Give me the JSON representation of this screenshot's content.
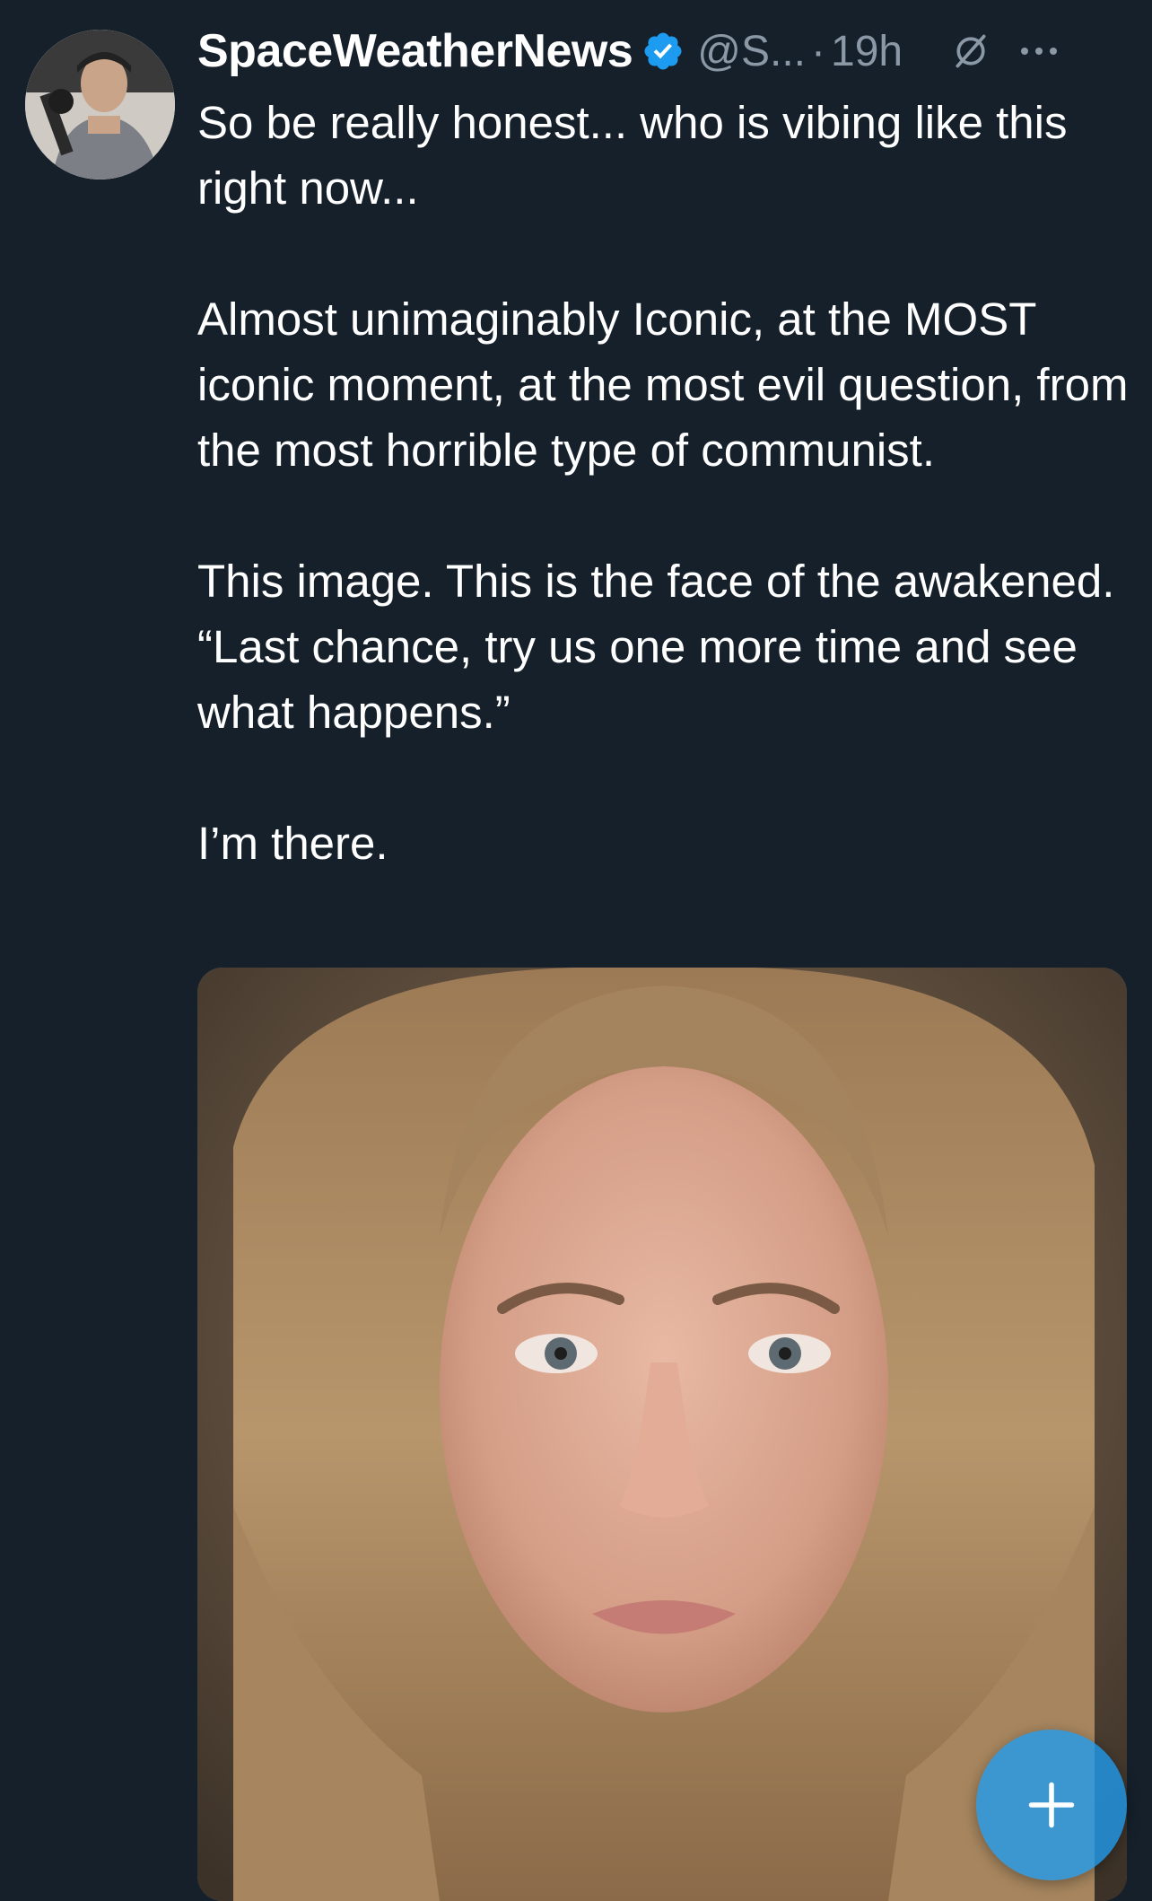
{
  "tweet": {
    "display_name": "SpaceWeatherNews",
    "handle": "@S...",
    "separator": "·",
    "time": "19h",
    "paragraphs": [
      "So be really honest... who is vibing like this right now...",
      "Almost unimaginably Iconic, at the MOST iconic moment, at the most evil question, from the most horrible type of communist.",
      "This image. This is the face of the awakened. “Last chance, try us one more time and see what happens.”",
      "I’m there."
    ]
  },
  "icons": {
    "verified": "verified-badge-icon",
    "grok": "grok-icon",
    "more": "more-options-icon",
    "compose": "plus-icon"
  },
  "colors": {
    "background": "#15202b",
    "accent": "#1d9bf0",
    "secondary_text": "#8b98a5"
  }
}
